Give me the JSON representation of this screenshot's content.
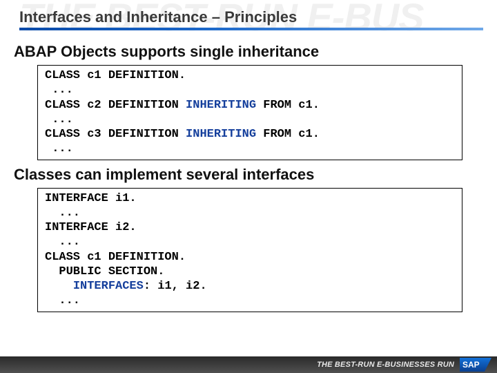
{
  "watermark_text": "THE BEST-RUN E-BUS",
  "header": {
    "title": "Interfaces and Inheritance – Principles"
  },
  "section1": {
    "heading": "ABAP Objects supports single inheritance",
    "code": [
      [
        {
          "t": "CLASS c1 DEFINITION."
        }
      ],
      [
        {
          "t": " ..."
        }
      ],
      [
        {
          "t": "CLASS c2 DEFINITION "
        },
        {
          "t": "INHERITING",
          "c": "kw-blue"
        },
        {
          "t": " FROM c1."
        }
      ],
      [
        {
          "t": " ..."
        }
      ],
      [
        {
          "t": "CLASS c3 DEFINITION "
        },
        {
          "t": "INHERITING",
          "c": "kw-blue"
        },
        {
          "t": " FROM c1."
        }
      ],
      [
        {
          "t": " ..."
        }
      ]
    ]
  },
  "section2": {
    "heading": "Classes can implement several interfaces",
    "code": [
      [
        {
          "t": "INTERFACE i1."
        }
      ],
      [
        {
          "t": "  ..."
        }
      ],
      [
        {
          "t": "INTERFACE i2."
        }
      ],
      [
        {
          "t": "  ..."
        }
      ],
      [
        {
          "t": "CLASS c1 DEFINITION."
        }
      ],
      [
        {
          "t": "  PUBLIC SECTION."
        }
      ],
      [
        {
          "t": "    "
        },
        {
          "t": "INTERFACES",
          "c": "kw-blue"
        },
        {
          "t": ": i1, i2."
        }
      ],
      [
        {
          "t": "  ..."
        }
      ]
    ]
  },
  "footer": {
    "tagline": "THE BEST-RUN E-BUSINESSES RUN",
    "logo_text": "SAP"
  }
}
